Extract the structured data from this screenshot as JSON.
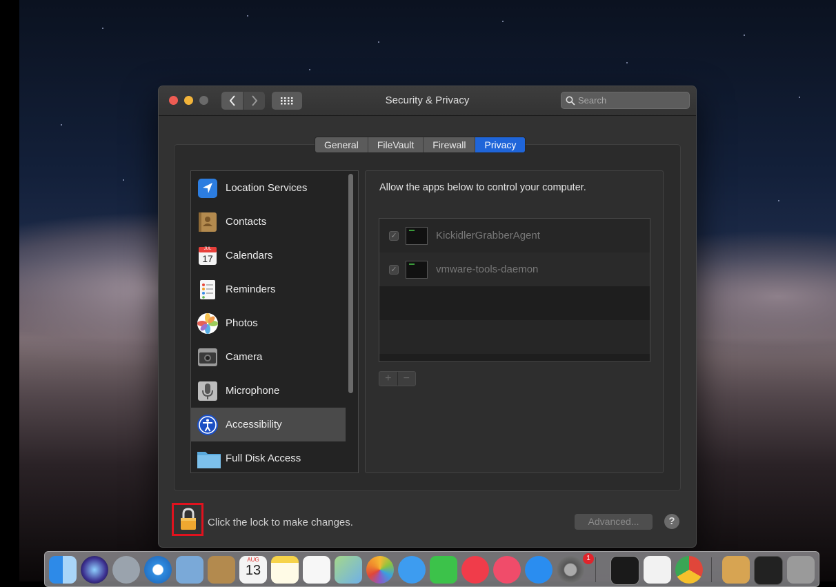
{
  "window": {
    "title": "Security & Privacy",
    "search_placeholder": "Search"
  },
  "tabs": [
    {
      "label": "General",
      "selected": false
    },
    {
      "label": "FileVault",
      "selected": false
    },
    {
      "label": "Firewall",
      "selected": false
    },
    {
      "label": "Privacy",
      "selected": true
    }
  ],
  "sidebar": {
    "items": [
      {
        "label": "Location Services",
        "icon": "location-arrow-icon",
        "selected": false
      },
      {
        "label": "Contacts",
        "icon": "contacts-book-icon",
        "selected": false
      },
      {
        "label": "Calendars",
        "icon": "calendar-icon",
        "selected": false,
        "calendar_month": "JUL",
        "calendar_day": "17"
      },
      {
        "label": "Reminders",
        "icon": "reminders-list-icon",
        "selected": false
      },
      {
        "label": "Photos",
        "icon": "photos-flower-icon",
        "selected": false
      },
      {
        "label": "Camera",
        "icon": "camera-icon",
        "selected": false
      },
      {
        "label": "Microphone",
        "icon": "microphone-icon",
        "selected": false
      },
      {
        "label": "Accessibility",
        "icon": "accessibility-icon",
        "selected": true
      },
      {
        "label": "Full Disk Access",
        "icon": "folder-icon",
        "selected": false
      }
    ]
  },
  "panel": {
    "description": "Allow the apps below to control your computer.",
    "apps": [
      {
        "name": "KickidlerGrabberAgent",
        "checked": true,
        "icon": "terminal-icon"
      },
      {
        "name": "vmware-tools-daemon",
        "checked": true,
        "icon": "terminal-icon"
      }
    ],
    "add_label": "+",
    "remove_label": "−"
  },
  "footer": {
    "lock_text": "Click the lock to make changes.",
    "advanced_label": "Advanced...",
    "help_label": "?"
  },
  "dock": {
    "items": [
      {
        "name": "finder-icon"
      },
      {
        "name": "siri-icon"
      },
      {
        "name": "launchpad-icon"
      },
      {
        "name": "safari-icon"
      },
      {
        "name": "mail-icon"
      },
      {
        "name": "contacts-icon"
      },
      {
        "name": "calendar-icon",
        "month": "AUG",
        "day": "13"
      },
      {
        "name": "notes-icon"
      },
      {
        "name": "reminders-icon"
      },
      {
        "name": "maps-icon"
      },
      {
        "name": "photos-icon"
      },
      {
        "name": "messages-icon"
      },
      {
        "name": "facetime-icon"
      },
      {
        "name": "news-icon"
      },
      {
        "name": "music-icon"
      },
      {
        "name": "app-store-icon"
      },
      {
        "name": "system-preferences-icon",
        "badge": "1"
      },
      {
        "name": "terminal-icon"
      },
      {
        "name": "textedit-icon"
      },
      {
        "name": "chrome-icon"
      },
      {
        "name": "package-icon"
      },
      {
        "name": "screen-icon"
      },
      {
        "name": "trash-icon"
      }
    ]
  },
  "colors": {
    "accent": "#1f65d9",
    "lock_highlight": "#e0121e",
    "window_bg": "#323232"
  }
}
